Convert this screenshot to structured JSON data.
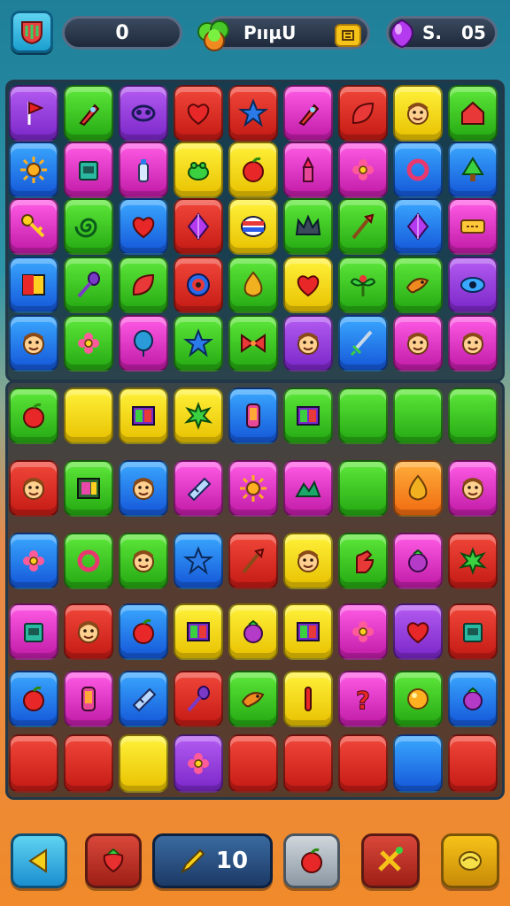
{
  "hud": {
    "score": "0",
    "label": "PııµU",
    "currency_a": "S.",
    "currency_b": "05",
    "icons": [
      "menu-shield-icon",
      "green-gem-icon",
      "yellow-badge-icon",
      "purple-gem-icon"
    ]
  },
  "board": {
    "columns": 9,
    "rows": 11,
    "tiles": [
      [
        "purple:flag",
        "green:rocket",
        "purple:mask",
        "red:heart",
        "red:star",
        "pink:rocket",
        "red:leaf",
        "yellow:face",
        "green:house"
      ],
      [
        "blue:sun",
        "pink:box",
        "pink:bottle",
        "yellow:frog",
        "yellow:apple",
        "pink:lipstick",
        "pink:flower",
        "blue:ring",
        "blue:tree"
      ],
      [
        "pink:key",
        "green:swirl",
        "blue:heart",
        "red:gem",
        "yellow:flag-stripe",
        "green:crown",
        "green:brush",
        "blue:gem",
        "pink:ticket"
      ],
      [
        "blue:square",
        "green:spoon",
        "green:leaf",
        "red:target",
        "green:drop",
        "yellow:heart",
        "green:plant",
        "green:bird",
        "purple:eye"
      ],
      [
        "blue:face",
        "green:flower",
        "pink:balloon",
        "green:star",
        "green:bow",
        "purple:face",
        "blue:sword",
        "pink:face",
        "pink:face"
      ],
      [
        "green:apple",
        "yellow:none",
        "yellow:book",
        "yellow:splat",
        "blue:phone",
        "green:book",
        "green:none",
        "green:none",
        "green:none"
      ],
      [
        "red:face",
        "green:frame",
        "blue:face",
        "pink:bandage",
        "pink:sun",
        "pink:mountain",
        "green:none",
        "orange:drop",
        "pink:face"
      ],
      [
        "blue:flower",
        "green:ring",
        "green:face",
        "blue:star",
        "red:brush",
        "yellow:face",
        "green:hand",
        "pink:berry",
        "red:splat"
      ],
      [
        "pink:box",
        "red:face",
        "blue:apple",
        "yellow:book",
        "yellow:berry",
        "yellow:book",
        "pink:flower",
        "purple:heart",
        "red:box"
      ],
      [
        "blue:apple",
        "pink:phone",
        "blue:bandage",
        "red:spoon",
        "green:bird",
        "yellow:stick",
        "pink:question",
        "green:orb",
        "blue:berry"
      ],
      [
        "red:none",
        "red:none",
        "yellow:none",
        "purple:flower",
        "red:none",
        "red:none",
        "red:none",
        "blue:none",
        "red:none"
      ]
    ]
  },
  "bottom_bar": {
    "buttons": [
      {
        "name": "back-button",
        "icon": "arrow-left-icon",
        "color": "blue"
      },
      {
        "name": "strawberry-button",
        "icon": "strawberry-icon",
        "color": "red"
      },
      {
        "name": "moves-button",
        "icon": "pencil-icon",
        "color": "wide",
        "label": "10"
      },
      {
        "name": "apple-button",
        "icon": "apple-icon",
        "color": "gray"
      },
      {
        "name": "tools-button",
        "icon": "tools-icon",
        "color": "red"
      },
      {
        "name": "hint-button",
        "icon": "lemon-icon",
        "color": "gold"
      }
    ]
  }
}
